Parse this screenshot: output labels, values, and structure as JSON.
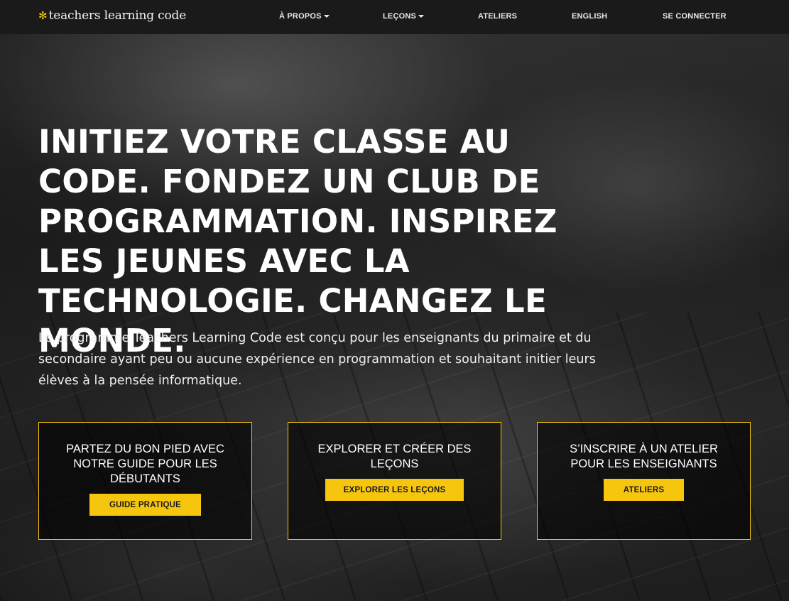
{
  "brand": {
    "mark": "✻",
    "name": "teachers learning code",
    "accent_color": "#f6c60f"
  },
  "nav": {
    "items": [
      {
        "label": "À PROPOS",
        "has_dropdown": true
      },
      {
        "label": "LEÇONS",
        "has_dropdown": true
      },
      {
        "label": "ATELIERS",
        "has_dropdown": false
      },
      {
        "label": "ENGLISH",
        "has_dropdown": false
      },
      {
        "label": "SE CONNECTER",
        "has_dropdown": false
      }
    ]
  },
  "hero": {
    "headline": "INITIEZ VOTRE CLASSE AU CODE. FONDEZ UN CLUB DE PROGRAMMATION. INSPIREZ LES JEUNES AVEC LA TECHNOLOGIE. CHANGEZ LE MONDE.",
    "intro": "Le programme Teachers Learning Code est conçu pour les enseignants du primaire et du secondaire ayant peu ou aucune expérience en programmation et souhaitant initier leurs élèves à la pensée informatique."
  },
  "cards": [
    {
      "title": "PARTEZ DU BON PIED AVEC NOTRE GUIDE POUR LES DÉBUTANTS",
      "button": "GUIDE PRATIQUE"
    },
    {
      "title": "EXPLORER ET CRÉER DES LEÇONS",
      "button": "EXPLORER LES LEÇONS"
    },
    {
      "title": "S’INSCRIRE À UN ATELIER POUR LES ENSEIGNANTS",
      "button": "ATELIERS"
    }
  ]
}
